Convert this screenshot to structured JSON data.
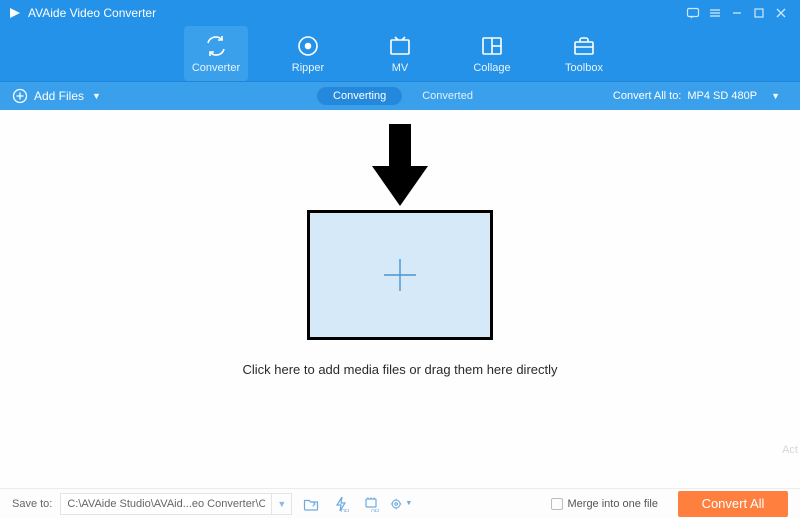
{
  "app": {
    "title": "AVAide Video Converter"
  },
  "tabs": {
    "converter": "Converter",
    "ripper": "Ripper",
    "mv": "MV",
    "collage": "Collage",
    "toolbox": "Toolbox"
  },
  "subbar": {
    "add_files": "Add Files",
    "converting": "Converting",
    "converted": "Converted",
    "convert_all_to": "Convert All to:",
    "format_selected": "MP4 SD 480P"
  },
  "canvas": {
    "hint": "Click here to add media files or drag them here directly"
  },
  "footer": {
    "save_to_label": "Save to:",
    "path": "C:\\AVAide Studio\\AVAid...eo Converter\\Converted",
    "merge_label": "Merge into one file",
    "convert_all": "Convert All"
  },
  "watermark": "Act"
}
